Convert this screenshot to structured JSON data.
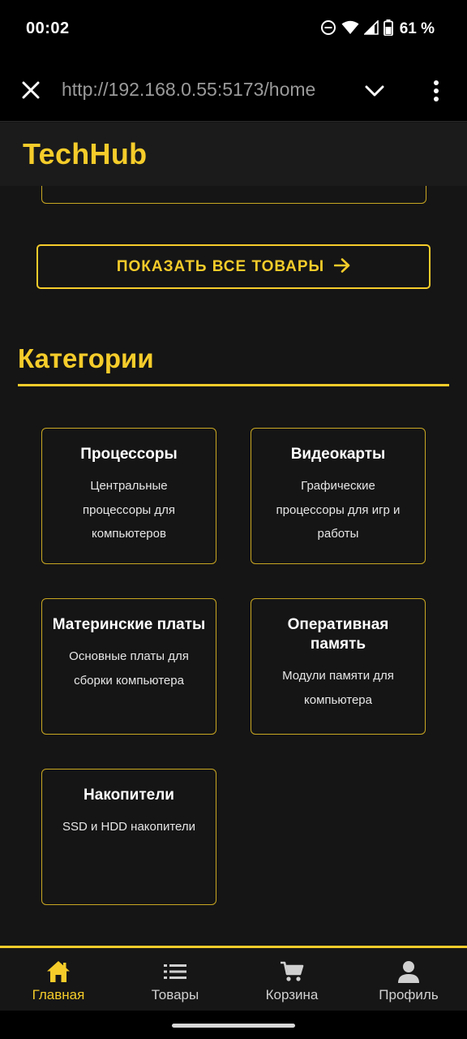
{
  "status_bar": {
    "time": "00:02",
    "battery_percent": "61 %",
    "icons": [
      "do-not-disturb-icon",
      "wifi-icon",
      "signal-icon",
      "battery-icon"
    ]
  },
  "browser": {
    "url": "http://192.168.0.55:5173/home",
    "icons": [
      "close-icon",
      "chevron-down-icon",
      "more-vert-icon"
    ]
  },
  "header": {
    "logo": "TechHub"
  },
  "main": {
    "show_all_label": "ПОКАЗАТЬ ВСЕ ТОВАРЫ",
    "show_all_icon": "arrow-right-icon",
    "categories_title": "Категории",
    "categories": [
      {
        "name": "Процессоры",
        "description": "Центральные процессоры для компьютеров"
      },
      {
        "name": "Видеокарты",
        "description": "Графические процессоры для игр и работы"
      },
      {
        "name": "Материнские платы",
        "description": "Основные платы для сборки компьютера"
      },
      {
        "name": "Оперативная память",
        "description": "Модули памяти для компьютера"
      },
      {
        "name": "Накопители",
        "description": "SSD и HDD накопители"
      }
    ]
  },
  "bottom_nav": {
    "items": [
      {
        "label": "Главная",
        "icon": "home-icon",
        "active": true
      },
      {
        "label": "Товары",
        "icon": "list-icon",
        "active": false
      },
      {
        "label": "Корзина",
        "icon": "cart-icon",
        "active": false
      },
      {
        "label": "Профиль",
        "icon": "person-icon",
        "active": false
      }
    ]
  },
  "colors": {
    "accent": "#f5cc2a",
    "background": "#151515",
    "card_border": "#c9a722"
  }
}
